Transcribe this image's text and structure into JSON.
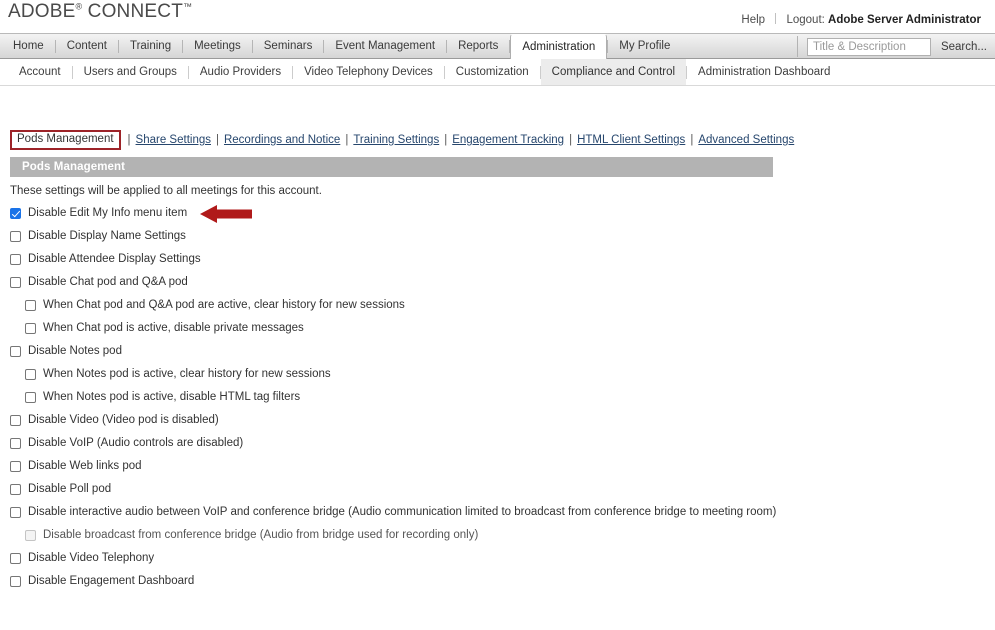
{
  "brand": {
    "name_primary": "ADOBE",
    "reg_mark": "®",
    "name_secondary": "CONNECT",
    "tm_mark": "™"
  },
  "colors": {
    "annotation_red": "#b01a1a",
    "highlight_box_red": "#9d2328",
    "band_gray": "#b3b3b3",
    "checkbox_blue": "#1a73e8",
    "link_blue": "#26466d"
  },
  "utility_bar": {
    "help_label": "Help",
    "logout_label": "Logout:",
    "user_name": "Adobe Server Administrator"
  },
  "primary_nav": {
    "tabs": [
      {
        "label": "Home",
        "active": false
      },
      {
        "label": "Content",
        "active": false
      },
      {
        "label": "Training",
        "active": false
      },
      {
        "label": "Meetings",
        "active": false
      },
      {
        "label": "Seminars",
        "active": false
      },
      {
        "label": "Event Management",
        "active": false
      },
      {
        "label": "Reports",
        "active": false
      },
      {
        "label": "Administration",
        "active": true
      },
      {
        "label": "My Profile",
        "active": false
      }
    ]
  },
  "search": {
    "placeholder": "Title & Description",
    "value": "",
    "button_label": "Search..."
  },
  "secondary_nav": {
    "items": [
      {
        "label": "Account",
        "active": false
      },
      {
        "label": "Users and Groups",
        "active": false
      },
      {
        "label": "Audio Providers",
        "active": false
      },
      {
        "label": "Video Telephony Devices",
        "active": false
      },
      {
        "label": "Customization",
        "active": false
      },
      {
        "label": "Compliance and Control",
        "active": true
      },
      {
        "label": "Administration Dashboard",
        "active": false
      }
    ]
  },
  "subnav": {
    "current": "Pods Management",
    "links": [
      "Share Settings",
      "Recordings and Notice",
      "Training Settings",
      "Engagement Tracking",
      "HTML Client Settings",
      "Advanced Settings"
    ],
    "separator": "|"
  },
  "section": {
    "title": "Pods Management",
    "intro": "These settings will be applied to all meetings for this account."
  },
  "options": [
    {
      "label": "Disable Edit My Info menu item",
      "checked": true,
      "indent": false,
      "disabled": false,
      "annotated": true
    },
    {
      "label": "Disable Display Name Settings",
      "checked": false,
      "indent": false,
      "disabled": false,
      "annotated": false
    },
    {
      "label": "Disable Attendee Display Settings",
      "checked": false,
      "indent": false,
      "disabled": false,
      "annotated": false
    },
    {
      "label": "Disable Chat pod and Q&A pod",
      "checked": false,
      "indent": false,
      "disabled": false,
      "annotated": false
    },
    {
      "label": "When Chat pod and Q&A pod are active, clear history for new sessions",
      "checked": false,
      "indent": true,
      "disabled": false,
      "annotated": false
    },
    {
      "label": "When Chat pod is active, disable private messages",
      "checked": false,
      "indent": true,
      "disabled": false,
      "annotated": false
    },
    {
      "label": "Disable Notes pod",
      "checked": false,
      "indent": false,
      "disabled": false,
      "annotated": false
    },
    {
      "label": "When Notes pod is active, clear history for new sessions",
      "checked": false,
      "indent": true,
      "disabled": false,
      "annotated": false
    },
    {
      "label": "When Notes pod is active, disable HTML tag filters",
      "checked": false,
      "indent": true,
      "disabled": false,
      "annotated": false
    },
    {
      "label": "Disable Video (Video pod is disabled)",
      "checked": false,
      "indent": false,
      "disabled": false,
      "annotated": false
    },
    {
      "label": "Disable VoIP (Audio controls are disabled)",
      "checked": false,
      "indent": false,
      "disabled": false,
      "annotated": false
    },
    {
      "label": "Disable Web links pod",
      "checked": false,
      "indent": false,
      "disabled": false,
      "annotated": false
    },
    {
      "label": "Disable Poll pod",
      "checked": false,
      "indent": false,
      "disabled": false,
      "annotated": false
    },
    {
      "label": "Disable interactive audio between VoIP and conference bridge (Audio communication limited to broadcast from conference bridge to meeting room)",
      "checked": false,
      "indent": false,
      "disabled": false,
      "annotated": false
    },
    {
      "label": "Disable broadcast from conference bridge (Audio from bridge used for recording only)",
      "checked": false,
      "indent": true,
      "disabled": true,
      "annotated": false
    },
    {
      "label": "Disable Video Telephony",
      "checked": false,
      "indent": false,
      "disabled": false,
      "annotated": false
    },
    {
      "label": "Disable Engagement Dashboard",
      "checked": false,
      "indent": false,
      "disabled": false,
      "annotated": false
    }
  ]
}
